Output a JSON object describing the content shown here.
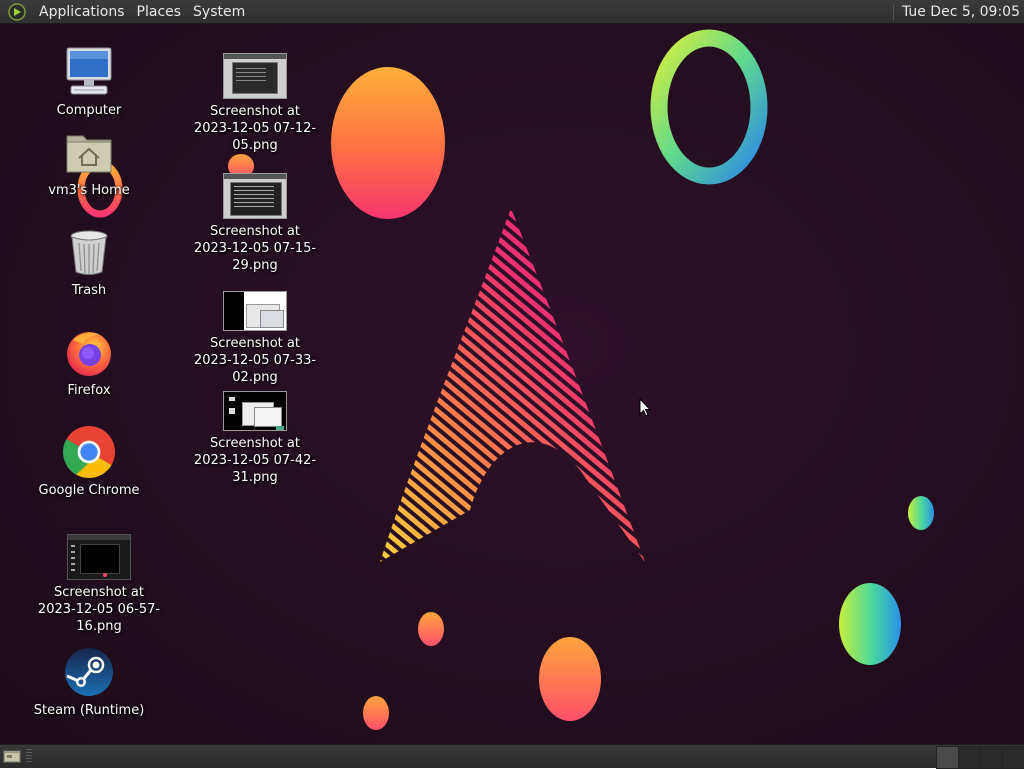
{
  "top_panel": {
    "menus": [
      "Applications",
      "Places",
      "System"
    ],
    "clock": "Tue Dec 5, 09:05"
  },
  "desktop_icons": {
    "computer": "Computer",
    "home": "vm3's Home",
    "trash": "Trash",
    "firefox": "Firefox",
    "chrome": "Google Chrome",
    "screenshot_0657": "Screenshot at 2023-12-05 06-57-16.png",
    "steam": "Steam (Runtime)",
    "screenshot_0712": "Screenshot at 2023-12-05 07-12-05.png",
    "screenshot_0715": "Screenshot at 2023-12-05 07-15-29.png",
    "screenshot_0733": "Screenshot at 2023-12-05 07-33-02.png",
    "screenshot_0742": "Screenshot at 2023-12-05 07-42-31.png"
  },
  "icons": [
    "computer-icon",
    "home-folder-icon",
    "trash-icon",
    "firefox-icon",
    "chrome-icon",
    "steam-icon",
    "image-thumbnail-icon",
    "menu-logo-icon",
    "show-desktop-icon",
    "mouse-cursor-icon"
  ],
  "colors": {
    "panel": "#333333",
    "wallpaper_base": "#2a0f22",
    "accent_pink": "#e8236f",
    "accent_orange": "#ff8a3a"
  }
}
